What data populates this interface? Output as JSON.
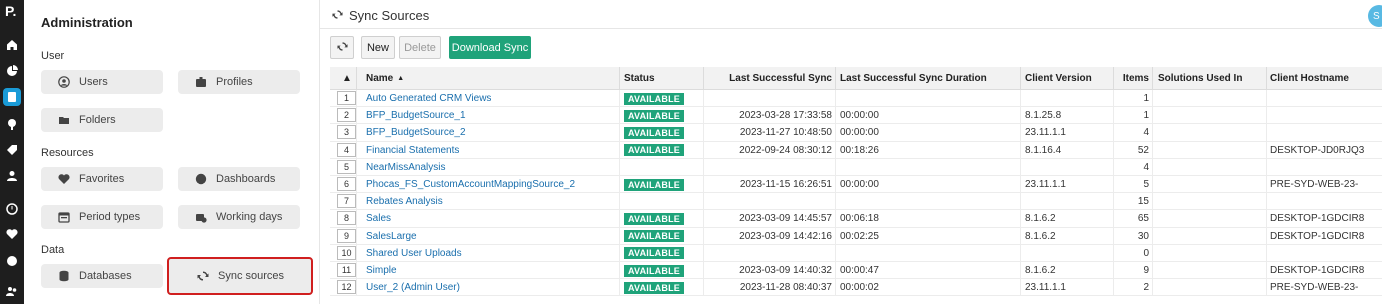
{
  "rail": {
    "logo": "P.",
    "icons": [
      "home-icon",
      "chart-icon",
      "sync-icon",
      "search-icon",
      "tag-icon",
      "person-icon",
      "history-icon",
      "heart-icon",
      "gauge-icon",
      "users-icon"
    ]
  },
  "admin": {
    "title": "Administration",
    "sections": {
      "user": "User",
      "resources": "Resources",
      "data": "Data"
    },
    "tiles": {
      "users": "Users",
      "profiles": "Profiles",
      "folders": "Folders",
      "favorites": "Favorites",
      "dashboards": "Dashboards",
      "period_types": "Period types",
      "working_days": "Working days",
      "databases": "Databases",
      "sync_sources": "Sync sources"
    }
  },
  "main": {
    "title": "Sync Sources",
    "user_initial": "S",
    "toolbar": {
      "new": "New",
      "delete": "Delete",
      "download": "Download Sync"
    }
  },
  "colors": {
    "accent_green": "#1fa37a",
    "link_blue": "#1a6fad",
    "highlight_red": "#d01f1f",
    "rail_dark": "#1e1e1e"
  },
  "table": {
    "columns": {
      "name": "Name",
      "status": "Status",
      "last_sync": "Last Successful Sync",
      "duration": "Last Successful Sync Duration",
      "client_version": "Client Version",
      "items": "Items",
      "solutions": "Solutions Used In",
      "hostname": "Client Hostname"
    },
    "rows": [
      {
        "num": "1",
        "name": "Auto Generated CRM Views",
        "status": "AVAILABLE",
        "last": "",
        "dur": "",
        "ver": "",
        "items": "1",
        "sol": "",
        "host": ""
      },
      {
        "num": "2",
        "name": "BFP_BudgetSource_1",
        "status": "AVAILABLE",
        "last": "2023-03-28 17:33:58",
        "dur": "00:00:00",
        "ver": "8.1.25.8",
        "items": "1",
        "sol": "",
        "host": ""
      },
      {
        "num": "3",
        "name": "BFP_BudgetSource_2",
        "status": "AVAILABLE",
        "last": "2023-11-27 10:48:50",
        "dur": "00:00:00",
        "ver": "23.11.1.1",
        "items": "4",
        "sol": "",
        "host": ""
      },
      {
        "num": "4",
        "name": "Financial Statements",
        "status": "AVAILABLE",
        "last": "2022-09-24 08:30:12",
        "dur": "00:18:26",
        "ver": "8.1.16.4",
        "items": "52",
        "sol": "",
        "host": "DESKTOP-JD0RJQ3"
      },
      {
        "num": "5",
        "name": "NearMissAnalysis",
        "status": "",
        "last": "",
        "dur": "",
        "ver": "",
        "items": "4",
        "sol": "",
        "host": ""
      },
      {
        "num": "6",
        "name": "Phocas_FS_CustomAccountMappingSource_2",
        "status": "AVAILABLE",
        "last": "2023-11-15 16:26:51",
        "dur": "00:00:00",
        "ver": "23.11.1.1",
        "items": "5",
        "sol": "",
        "host": "PRE-SYD-WEB-23-"
      },
      {
        "num": "7",
        "name": "Rebates Analysis",
        "status": "",
        "last": "",
        "dur": "",
        "ver": "",
        "items": "15",
        "sol": "",
        "host": ""
      },
      {
        "num": "8",
        "name": "Sales",
        "status": "AVAILABLE",
        "last": "2023-03-09 14:45:57",
        "dur": "00:06:18",
        "ver": "8.1.6.2",
        "items": "65",
        "sol": "",
        "host": "DESKTOP-1GDCIR8"
      },
      {
        "num": "9",
        "name": "SalesLarge",
        "status": "AVAILABLE",
        "last": "2023-03-09 14:42:16",
        "dur": "00:02:25",
        "ver": "8.1.6.2",
        "items": "30",
        "sol": "",
        "host": "DESKTOP-1GDCIR8"
      },
      {
        "num": "10",
        "name": "Shared User Uploads",
        "status": "AVAILABLE",
        "last": "",
        "dur": "",
        "ver": "",
        "items": "0",
        "sol": "",
        "host": ""
      },
      {
        "num": "11",
        "name": "Simple",
        "status": "AVAILABLE",
        "last": "2023-03-09 14:40:32",
        "dur": "00:00:47",
        "ver": "8.1.6.2",
        "items": "9",
        "sol": "",
        "host": "DESKTOP-1GDCIR8"
      },
      {
        "num": "12",
        "name": "User_2 (Admin User)",
        "status": "AVAILABLE",
        "last": "2023-11-28 08:40:37",
        "dur": "00:00:02",
        "ver": "23.11.1.1",
        "items": "2",
        "sol": "",
        "host": "PRE-SYD-WEB-23-"
      }
    ]
  }
}
